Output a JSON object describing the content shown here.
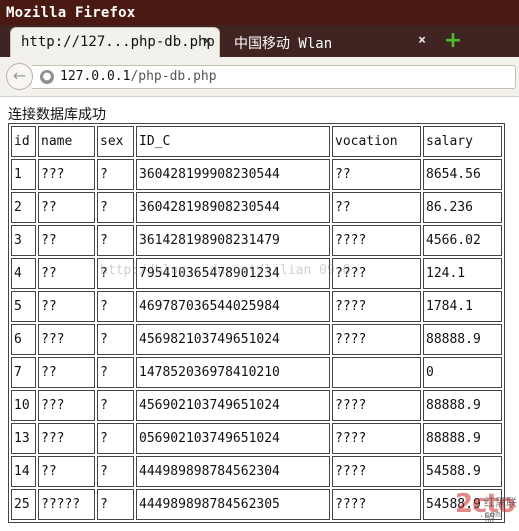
{
  "window": {
    "title": "Mozilla Firefox"
  },
  "tabs": [
    {
      "label": "http://127...php-db.php",
      "close": "×"
    },
    {
      "label": "中国移动 Wlan",
      "close": "×"
    }
  ],
  "newtab_symbol": "+",
  "nav": {
    "back_symbol": "←",
    "url_host": "127.0.0.1",
    "url_path": "/php-db.php"
  },
  "page": {
    "status": "连接数据库成功",
    "table": {
      "headers": [
        "id",
        "name",
        "sex",
        "ID_C",
        "vocation",
        "salary"
      ],
      "rows": [
        [
          "1",
          "???",
          "?",
          "360428199908230544",
          "??",
          "8654.56"
        ],
        [
          "2",
          "??",
          "?",
          "360428198908230544",
          "??",
          "86.236"
        ],
        [
          "3",
          "??",
          "?",
          "361428198908231479",
          "????",
          "4566.02"
        ],
        [
          "4",
          "??",
          "?",
          "795410365478901234",
          "????",
          "124.1"
        ],
        [
          "5",
          "??",
          "?",
          "469787036544025984",
          "????",
          "1784.1"
        ],
        [
          "6",
          "???",
          "?",
          "456982103749651024",
          "????",
          "88888.9"
        ],
        [
          "7",
          "??",
          "?",
          "147852036978410210",
          "",
          "0"
        ],
        [
          "10",
          "???",
          "?",
          "456902103749651024",
          "????",
          "88888.9"
        ],
        [
          "13",
          "???",
          "?",
          "056902103749651024",
          "????",
          "88888.9"
        ],
        [
          "14",
          "??",
          "?",
          "444989898784562304",
          "????",
          "54588.9"
        ],
        [
          "25",
          "?????",
          "?",
          "444989898784562305",
          "????",
          "54588.9"
        ]
      ]
    }
  },
  "overlay": {
    "watermark": "http://blog.csdn.net/lilian 09 0",
    "logo": "2cto",
    "logo_sub": "红黑联盟",
    "logo_url": ".com"
  }
}
